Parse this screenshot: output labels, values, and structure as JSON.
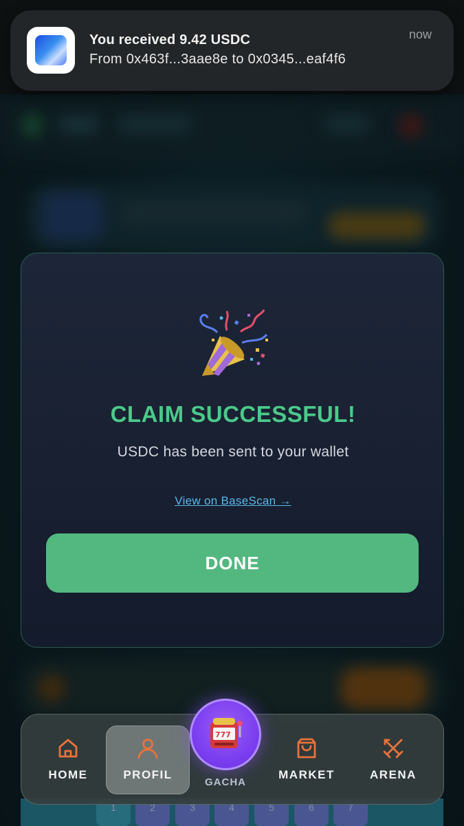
{
  "notification": {
    "title": "You received 9.42 USDC",
    "body": "From 0x463f...3aae8e to 0x0345...eaf4f6",
    "time": "now",
    "app_icon": "wallet-app-icon"
  },
  "modal": {
    "icon": "party-popper-icon",
    "title": "CLAIM SUCCESSFUL!",
    "subtitle": "USDC has been sent to your wallet",
    "link_label": "View on BaseScan →",
    "done_label": "DONE"
  },
  "nav": {
    "items": [
      {
        "label": "HOME",
        "icon": "home-icon"
      },
      {
        "label": "PROFIL",
        "icon": "user-icon",
        "active": true
      },
      {
        "label": "GACHA",
        "icon": "slot-machine-icon"
      },
      {
        "label": "MARKET",
        "icon": "shopping-bag-icon"
      },
      {
        "label": "ARENA",
        "icon": "crossed-swords-icon"
      }
    ]
  },
  "background_strip": {
    "cells": [
      "1",
      "2",
      "3",
      "4",
      "5",
      "6",
      "7"
    ]
  },
  "colors": {
    "accent_green": "#53b880",
    "title_green": "#4cc98a",
    "link_blue": "#5ab8e8",
    "nav_icon_orange": "#e8733a",
    "gacha_purple": "#7b3ff0"
  }
}
